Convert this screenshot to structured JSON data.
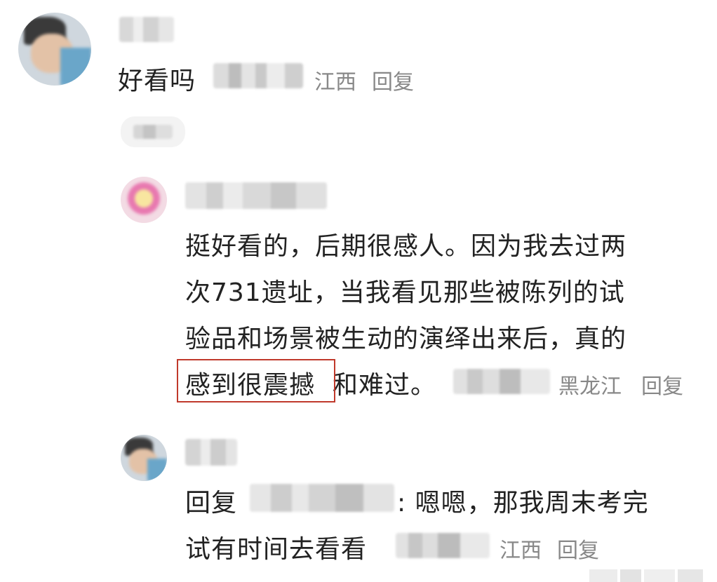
{
  "comments": [
    {
      "region": "江西",
      "reply_label": "回复",
      "text": "好看吗"
    },
    {
      "region": "黑龙江",
      "reply_label": "回复",
      "text_lines": [
        "挺好看的，后期很感人。因为我去过两",
        "次731遗址，当我看见那些被陈列的试",
        "验品和场景被生动的演绎出来后，真的"
      ],
      "highlight_text": "感到很震撼",
      "tail_text": "和难过。"
    },
    {
      "region": "江西",
      "reply_label": "回复",
      "reply_prefix": "回复",
      "reply_line1_rest": ": 嗯嗯，那我周末考完",
      "reply_line2": "试有时间去看看"
    }
  ],
  "colors": {
    "highlight_border": "#c0392b",
    "meta_text": "#888888",
    "main_text": "#222222"
  },
  "icons": {
    "avatar1": "user-avatar",
    "avatar2": "pink-flower-avatar",
    "avatar3": "user-avatar"
  }
}
